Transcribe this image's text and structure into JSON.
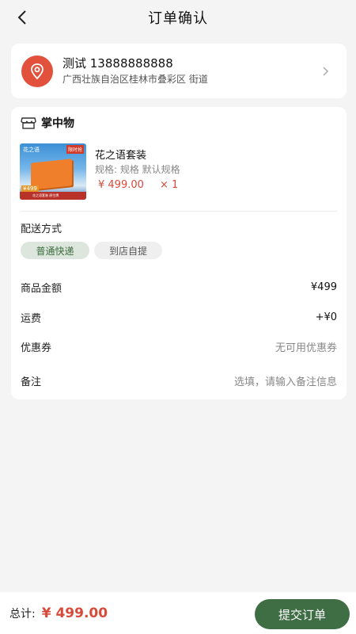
{
  "header": {
    "title": "订单确认"
  },
  "address": {
    "name_phone": "测试 13888888888",
    "detail": "广西壮族自治区桂林市叠彩区 街道"
  },
  "shop": {
    "name": "掌中物"
  },
  "product": {
    "name": "花之语套装",
    "spec": "规格: 规格 默认规格",
    "price": "¥ 499.00",
    "quantity": "× 1",
    "image_text_tl": "花之语",
    "image_text_tr": "限时抢",
    "image_price": "¥499",
    "image_strip": "花之语套装 原生牌"
  },
  "shipping": {
    "label": "配送方式",
    "options": [
      "普通快递",
      "到店自提"
    ]
  },
  "summary": {
    "goods_label": "商品金额",
    "goods_value": "¥499",
    "freight_label": "运费",
    "freight_value": "+¥0",
    "coupon_label": "优惠券",
    "coupon_value": "无可用优惠券",
    "note_label": "备注",
    "note_placeholder": "选填，请输入备注信息"
  },
  "footer": {
    "total_label": "总计:",
    "total_value": "¥ 499.00",
    "submit_label": "提交订单"
  },
  "colors": {
    "price": "#d84a3a",
    "accent_green": "#3f6e45",
    "chip_active_bg": "#dde6dc",
    "pin": "#e2513b"
  }
}
